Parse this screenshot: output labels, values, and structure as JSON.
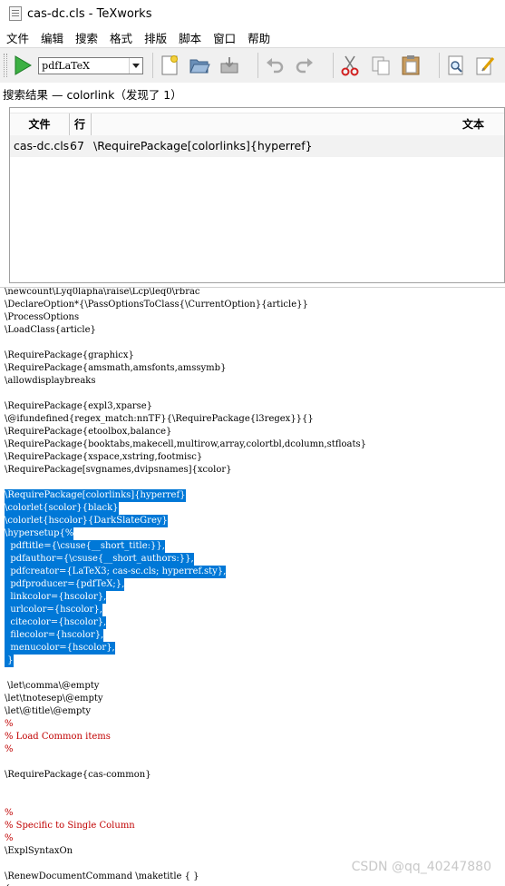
{
  "window": {
    "title": "cas-dc.cls - TeXworks"
  },
  "menubar": {
    "items": [
      "文件",
      "编辑",
      "搜索",
      "格式",
      "排版",
      "脚本",
      "窗口",
      "帮助"
    ]
  },
  "toolbar": {
    "engine": "pdfLaTeX",
    "icons": [
      "typeset-icon",
      "new-document-icon",
      "open-folder-icon",
      "save-icon",
      "undo-icon",
      "redo-icon",
      "cut-icon",
      "copy-icon",
      "paste-icon",
      "find-icon",
      "replace-icon"
    ]
  },
  "search": {
    "label": "搜索结果 — colorlink（发现了 1）",
    "headers": {
      "file": "文件",
      "line": "行",
      "text": "文本"
    },
    "result": {
      "file": "cas-dc.cls",
      "line": "67",
      "text": "\\RequirePackage[colorlinks]{hyperref}"
    }
  },
  "editor": {
    "lines": [
      "\\newcount\\Lyq0lapha\\raise\\Lcp\\leq0\\rbrac",
      "\\DeclareOption*{\\PassOptionsToClass{\\CurrentOption}{article}}",
      "\\ProcessOptions",
      "\\LoadClass{article}",
      "",
      "\\RequirePackage{graphicx}",
      "\\RequirePackage{amsmath,amsfonts,amssymb}",
      "\\allowdisplaybreaks",
      "",
      "\\RequirePackage{expl3,xparse}",
      "\\@ifundefined{regex_match:nnTF}{\\RequirePackage{l3regex}}{}",
      "\\RequirePackage{etoolbox,balance}",
      "\\RequirePackage{booktabs,makecell,multirow,array,colortbl,dcolumn,stfloats}",
      "\\RequirePackage{xspace,xstring,footmisc}",
      "\\RequirePackage[svgnames,dvipsnames]{xcolor}",
      "",
      "\\RequirePackage[colorlinks]{hyperref}",
      "\\colorlet{scolor}{black}",
      "\\colorlet{hscolor}{DarkSlateGrey}",
      "\\hypersetup{%",
      "  pdftitle={\\csuse{__short_title:}},",
      "  pdfauthor={\\csuse{__short_authors:}},",
      "  pdfcreator={LaTeX3; cas-sc.cls; hyperref.sty},",
      "  pdfproducer={pdfTeX;},",
      "  linkcolor={hscolor},",
      "  urlcolor={hscolor},",
      "  citecolor={hscolor},",
      "  filecolor={hscolor},",
      "  menucolor={hscolor},",
      " }",
      "",
      " \\let\\comma\\@empty",
      "\\let\\tnotesep\\@empty",
      "\\let\\@title\\@empty",
      "%",
      "% Load Common items",
      "%",
      "",
      "\\RequirePackage{cas-common}",
      "",
      "",
      "%",
      "% Specific to Single Column",
      "%",
      "\\ExplSyntaxOn",
      "",
      "\\RenewDocumentCommand \\maketitle { }",
      "{"
    ]
  },
  "watermark": "CSDN @qq_40247880",
  "colors": {
    "selection": "#0078d7",
    "comment": "#c00000",
    "command": "#001e90"
  }
}
